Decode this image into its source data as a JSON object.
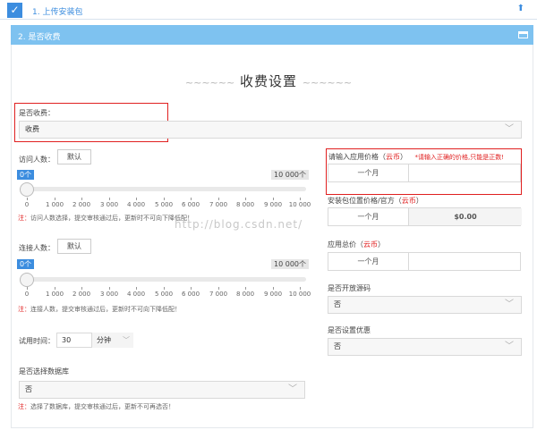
{
  "step1": {
    "label": "1. 上传安装包"
  },
  "step2": {
    "label": "2. 是否收费"
  },
  "title": {
    "decor_left": "~~~~~~",
    "text": "收费设置",
    "decor_right": "~~~~~~"
  },
  "charge": {
    "label": "是否收费：",
    "value": "收费"
  },
  "visits": {
    "label": "访问人数：",
    "default_btn": "默认",
    "min_tag": "0个",
    "max_tag": "10 000个",
    "ticks": [
      "0",
      "1 000",
      "2 000",
      "3 000",
      "4 000",
      "5 000",
      "6 000",
      "7 000",
      "8 000",
      "9 000",
      "10 000"
    ],
    "note_star": "注：",
    "note": "访问人数选择，提交审核通过后，更新时不可向下降低配！"
  },
  "connections": {
    "label": "连接人数：",
    "default_btn": "默认",
    "min_tag": "0个",
    "max_tag": "10 000个",
    "ticks": [
      "0",
      "1 000",
      "2 000",
      "3 000",
      "4 000",
      "5 000",
      "6 000",
      "7 000",
      "8 000",
      "9 000",
      "10 000"
    ],
    "note_star": "注：",
    "note": "连接人数，提交审核通过后，更新时不可向下降低配！"
  },
  "trial": {
    "label": "试用时间：",
    "value": "30",
    "unit": "分钟"
  },
  "database": {
    "label": "是否选择数据库",
    "value": "否",
    "note_star": "注：",
    "note": "选择了数据库，提交审核通过后，更新不可再选否！"
  },
  "price": {
    "label": "请输入应用价格（",
    "coin": "云币",
    "label_end": "）",
    "error": "*请输入正确的价格,只能是正数!",
    "period": "一个月",
    "value": ""
  },
  "install_price": {
    "label": "安装包位置价格/官方（",
    "coin": "云币",
    "label_end": "）",
    "period": "一个月",
    "value": "$0.00"
  },
  "total_price": {
    "label": "应用总价（",
    "coin": "云币",
    "label_end": "）",
    "period": "一个月",
    "value": ""
  },
  "open_source": {
    "label": "是否开放源码",
    "value": "否"
  },
  "discount": {
    "label": "是否设置优惠",
    "value": "否"
  },
  "watermark": "http://blog.csdn.net/",
  "colors": {
    "accent": "#3c8ddf",
    "header": "#7ec2f0",
    "error": "#e02020"
  }
}
